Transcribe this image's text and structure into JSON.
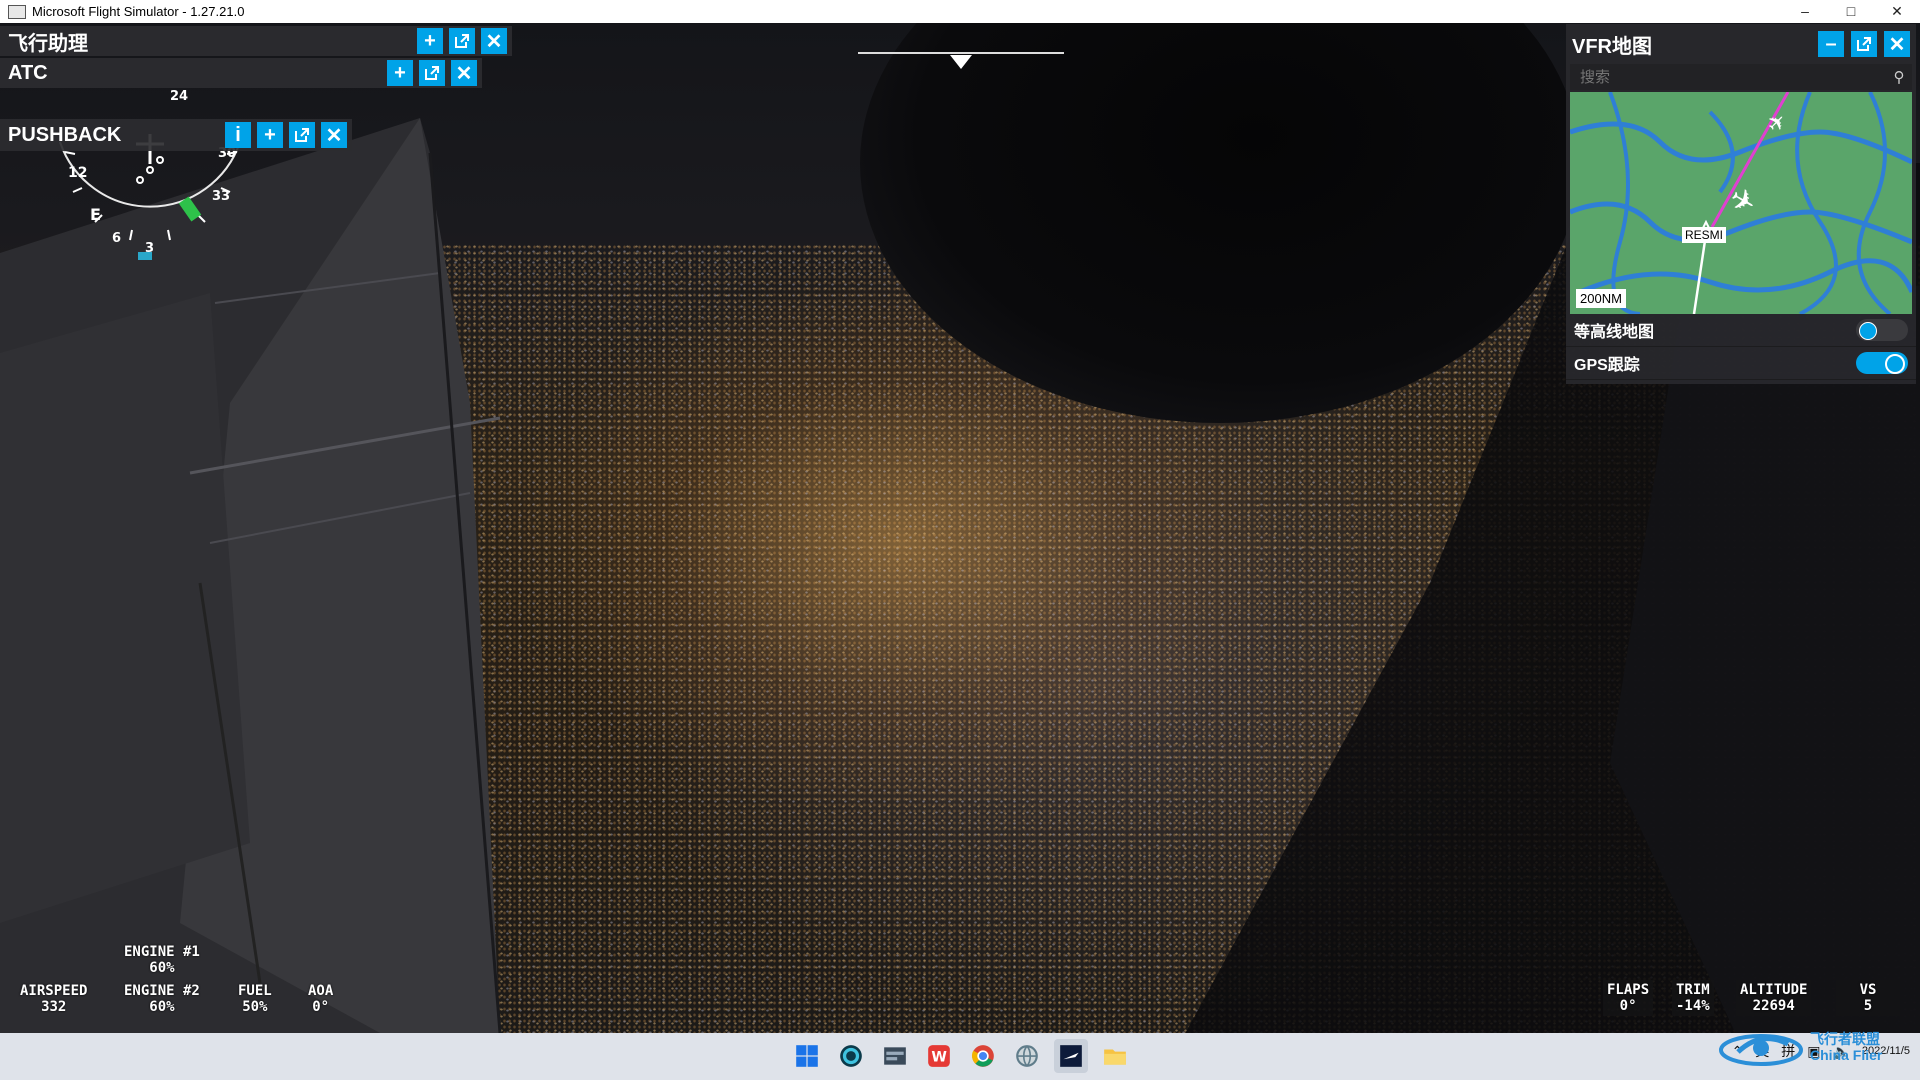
{
  "window": {
    "title": "Microsoft Flight Simulator - 1.27.21.0"
  },
  "panels": {
    "flight_assistant": {
      "title": "飞行助理"
    },
    "atc": {
      "title": "ATC"
    },
    "pushback": {
      "title": "PUSHBACK",
      "info_label": "i"
    }
  },
  "vfr_map": {
    "title": "VFR地图",
    "search_placeholder": "搜索",
    "scale": "200NM",
    "waypoint": "RESMI",
    "toggles": [
      {
        "label": "等高线地图",
        "state": "off"
      },
      {
        "label": "GPS跟踪",
        "state": "on"
      }
    ]
  },
  "hud": {
    "airspeed": {
      "label": "AIRSPEED",
      "value": "332"
    },
    "engine1": {
      "label": "ENGINE #1",
      "value": "60%"
    },
    "engine2": {
      "label": "ENGINE #2",
      "value": "60%"
    },
    "fuel": {
      "label": "FUEL",
      "value": "50%"
    },
    "aoa": {
      "label": "AOA",
      "value": "0°"
    },
    "flaps": {
      "label": "FLAPS",
      "value": "0°"
    },
    "trim": {
      "label": "TRIM",
      "value": "-14%"
    },
    "altitude": {
      "label": "ALTITUDE",
      "value": "22694"
    },
    "vs": {
      "label": "VS",
      "value": "5"
    }
  },
  "compass": {
    "labels": [
      "33",
      "3",
      "6",
      "E",
      "12",
      "24",
      "30"
    ]
  },
  "taskbar": {
    "ime_lang": "英",
    "ime_mode": "拼",
    "date": "2022/11/5",
    "watermark": "飞行者联盟 China Flier"
  },
  "colors": {
    "accent": "#00a3e8",
    "panel_bg": "#2d2d30",
    "map_green": "#5aa56a",
    "map_water": "#2f7fd6",
    "route": "#e040d0"
  }
}
